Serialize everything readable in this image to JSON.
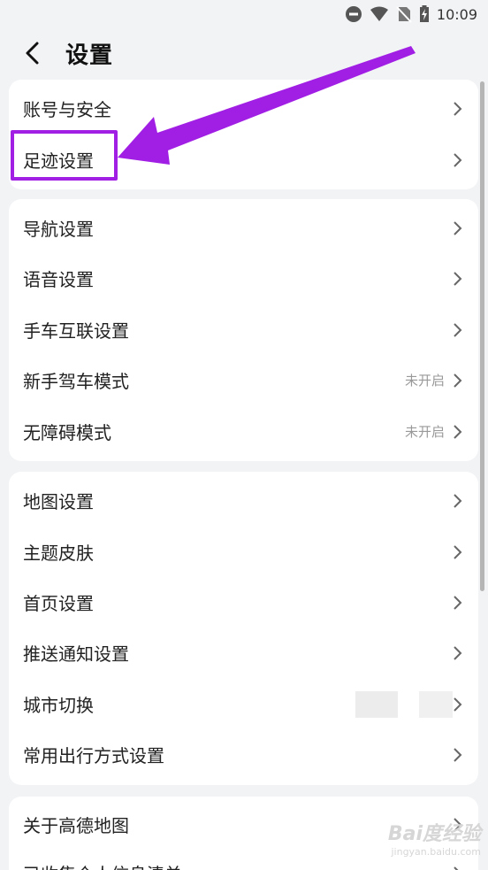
{
  "status": {
    "time": "10:09"
  },
  "header": {
    "title": "设置"
  },
  "groups": [
    {
      "items": [
        {
          "label": "账号与安全"
        },
        {
          "label": "足迹设置"
        }
      ]
    },
    {
      "items": [
        {
          "label": "导航设置"
        },
        {
          "label": "语音设置"
        },
        {
          "label": "手车互联设置"
        },
        {
          "label": "新手驾车模式",
          "value": "未开启"
        },
        {
          "label": "无障碍模式",
          "value": "未开启"
        }
      ]
    },
    {
      "items": [
        {
          "label": "地图设置"
        },
        {
          "label": "主题皮肤"
        },
        {
          "label": "首页设置"
        },
        {
          "label": "推送通知设置"
        },
        {
          "label": "城市切换"
        },
        {
          "label": "常用出行方式设置"
        }
      ]
    },
    {
      "items": [
        {
          "label": "关于高德地图"
        },
        {
          "label": "已收集个人信息清单"
        }
      ]
    }
  ],
  "watermark": {
    "brand": "Bai度经验",
    "url": "jingyan.baidu.com"
  },
  "colors": {
    "accent": "#a11fe4",
    "background": "#f2f3f5",
    "card": "#ffffff"
  }
}
